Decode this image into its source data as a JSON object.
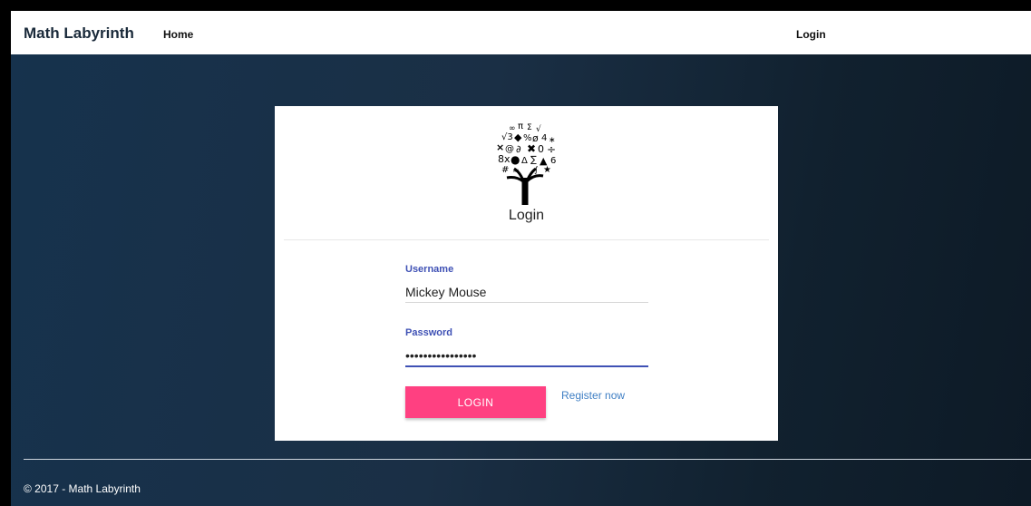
{
  "navbar": {
    "brand": "Math Labyrinth",
    "home_label": "Home",
    "login_label": "Login"
  },
  "card": {
    "logo_icon": "math-symbols-tree-icon",
    "title": "Login",
    "username": {
      "label": "Username",
      "value": "Mickey Mouse"
    },
    "password": {
      "label": "Password",
      "value": "••••••••••••••••"
    },
    "login_button_label": "LOGIN",
    "register_link": "Register now"
  },
  "footer": {
    "copyright": "© 2017 - Math Labyrinth"
  },
  "colors": {
    "accent_button": "#ff4081",
    "field_label": "#3f51b5",
    "link": "#3f7fc4",
    "background": "#16324d"
  }
}
